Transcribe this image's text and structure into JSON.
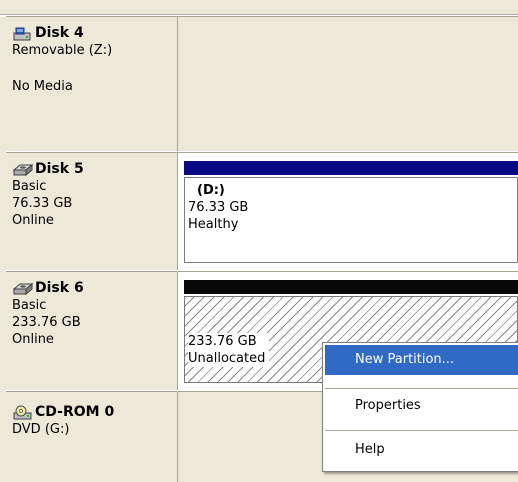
{
  "disks": [
    {
      "title": "Disk 4",
      "details": [
        "Removable (Z:)",
        "",
        "No Media"
      ],
      "icon": "removable-disk-icon"
    },
    {
      "title": "Disk 5",
      "details": [
        "Basic",
        "76.33 GB",
        "Online"
      ],
      "icon": "hard-disk-icon",
      "volume": {
        "letter": "(D:)",
        "size": "76.33 GB",
        "status": "Healthy"
      }
    },
    {
      "title": "Disk 6",
      "details": [
        "Basic",
        "233.76 GB",
        "Online"
      ],
      "icon": "hard-disk-icon",
      "volume": {
        "size": "233.76 GB",
        "status": "Unallocated"
      }
    },
    {
      "title": "CD-ROM 0",
      "details": [
        "DVD (G:)"
      ],
      "icon": "cdrom-icon"
    }
  ],
  "context_menu": {
    "items": [
      "New Partition...",
      "Properties",
      "Help"
    ],
    "selected": "New Partition..."
  },
  "colors": {
    "primary_partition_bar": "#0a0a84",
    "unallocated_bar": "#080808",
    "menu_highlight": "#316ac5"
  }
}
